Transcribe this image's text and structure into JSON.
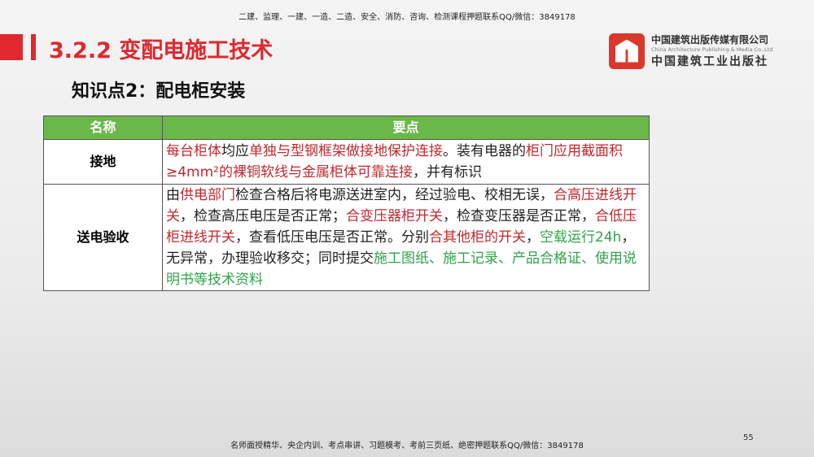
{
  "header_banner": "二建、监理、一建、一造、二造、安全、消防、咨询、检测课程押题联系QQ/微信：3849178",
  "footer_banner": "名师面授精华、央企内训、考点串讲、习题模考、考前三页纸、绝密押题联系QQ/微信：3849178",
  "title": "3.2.2 变配电施工技术",
  "subtitle": "知识点2：配电柜安装",
  "logo": {
    "cn": "中国建筑出版传媒有限公司",
    "en": "China Architecture Publishing & Media Co.,Ltd",
    "cn2": "中国建筑工业出版社"
  },
  "table": {
    "headers": [
      "名称",
      "要点"
    ],
    "rows": [
      {
        "name": "接地",
        "segments": [
          [
            "r",
            "每台柜体"
          ],
          [
            "k",
            "均应"
          ],
          [
            "r",
            "单独与型钢框架做接地保护连接"
          ],
          [
            "k",
            "。装有电器的"
          ],
          [
            "r",
            "柜门应用截面积≥4mm²的裸铜软线与金属柜体可靠连接"
          ],
          [
            "k",
            "，并有标识"
          ]
        ]
      },
      {
        "name": "送电验收",
        "segments": [
          [
            "k",
            "由"
          ],
          [
            "r",
            "供电部门"
          ],
          [
            "k",
            "检查合格后将电源送进室内，经过验电、校相无误，"
          ],
          [
            "r",
            "合高压进线开关"
          ],
          [
            "k",
            "，检查高压电压是否正常；"
          ],
          [
            "r",
            "合变压器柜开关"
          ],
          [
            "k",
            "，检查变压器是否正常，"
          ],
          [
            "r",
            "合低压柜进线开关"
          ],
          [
            "k",
            "，查看低压电压是否正常。分别"
          ],
          [
            "r",
            "合其他柜的开关"
          ],
          [
            "k",
            "，"
          ],
          [
            "g",
            "空载运行24h"
          ],
          [
            "k",
            "，无异常，办理验收移交；同时提交"
          ],
          [
            "g",
            "施工图纸、施工记录、产品合格证、使用说明书等技术资料"
          ]
        ]
      }
    ]
  },
  "page_number": "55",
  "colors": {
    "accent": "#e0282e",
    "header_green": "#6ab84a",
    "red_text": "#c0282e",
    "green_text": "#2fa34a"
  }
}
